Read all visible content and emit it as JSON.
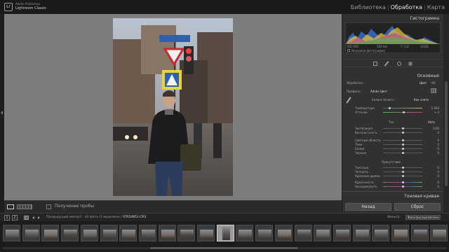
{
  "app": {
    "logo_abbr": "Lr",
    "vendor": "Adobe Photoshop",
    "name": "Lightroom Classic"
  },
  "modules": [
    {
      "label": "Библиотека",
      "active": false
    },
    {
      "label": "Обработка",
      "active": true
    },
    {
      "label": "Карта",
      "active": false
    }
  ],
  "toolbar": {
    "soft_proof_label": "Получение пробы"
  },
  "histogram": {
    "title": "Гистограмма",
    "iso": "ISO 400",
    "focal": "200 мм",
    "aperture": "f / 2,8",
    "shutter": "1/320",
    "original_label": "Исходная фотография"
  },
  "basic": {
    "title": "Основные",
    "treatment_label": "Обработка :",
    "treatment_value": "Цвет",
    "treatment_alt": "Ч/Б",
    "profile_label": "Профиль :",
    "profile_value": "Adobe Цвет",
    "wb_label": "Баланс белого :",
    "wb_value": "Как снято",
    "temp_label": "Температура",
    "temp_value": "5 000",
    "tint_label": "Оттенок",
    "tint_value": "+ 3",
    "tone_label": "Тон",
    "auto_label": "Авто",
    "exposure_label": "Экспозиция",
    "contrast_label": "Контрастность",
    "highlights_label": "Светлые области",
    "shadows_label": "Тени",
    "whites_label": "Белые",
    "blacks_label": "Черные",
    "presence_label": "Присутствие",
    "texture_label": "Текстура",
    "clarity_label": "Четкость",
    "dehaze_label": "Удаление дымки",
    "vibrance_label": "Красочность",
    "saturation_label": "Насыщенность",
    "zero": "0",
    "zero_exposure": "0,00"
  },
  "tone_curve": {
    "title": "Тоновая кривая"
  },
  "panel_buttons": {
    "previous": "Назад",
    "reset": "Сброс"
  },
  "filmstrip_bar": {
    "btn1": "1",
    "btn2": "2",
    "source": "Предыдущий импорт :",
    "count": "44 фото /1 выделено /",
    "filename": "STA54951.CR3",
    "filter_label": "Фильтр :",
    "filter_value": "Фильтры выключены"
  },
  "filmstrip": {
    "thumb_count": 23,
    "selected_index": 11
  },
  "colors": {
    "accent_text": "#e8e8e8",
    "panel_bg": "#313131",
    "viewer_bg": "#7d7d7d"
  }
}
